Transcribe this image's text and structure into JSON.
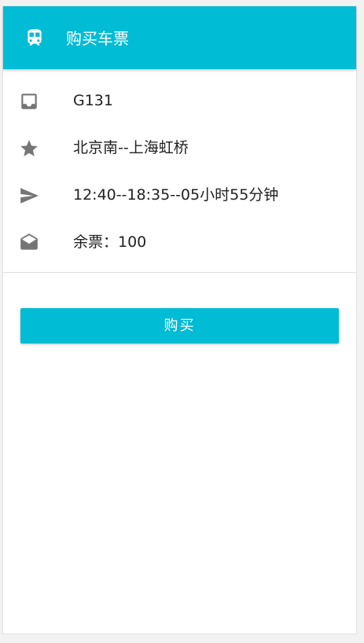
{
  "appbar": {
    "title": "购买车票",
    "icon": "train-icon"
  },
  "details": [
    {
      "icon": "inbox-icon",
      "text": "G131"
    },
    {
      "icon": "star-icon",
      "text": "北京南--上海虹桥"
    },
    {
      "icon": "send-icon",
      "text": "12:40--18:35--05小时55分钟"
    },
    {
      "icon": "mail-open-icon",
      "text": "余票：100"
    }
  ],
  "actions": {
    "buy_label": "购买"
  },
  "colors": {
    "primary": "#00bcd4",
    "icon": "#757575",
    "text": "#212121"
  }
}
